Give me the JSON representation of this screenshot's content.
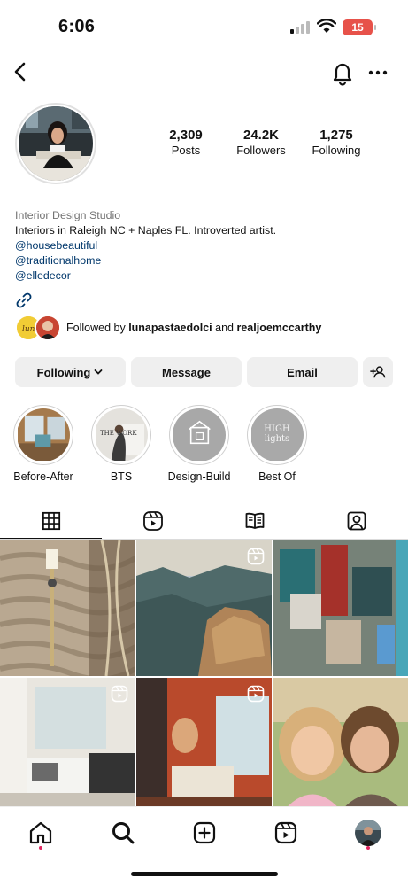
{
  "status_bar": {
    "time": "6:06",
    "battery": "15"
  },
  "profile": {
    "stats": [
      {
        "value": "2,309",
        "label": "Posts"
      },
      {
        "value": "24.2K",
        "label": "Followers"
      },
      {
        "value": "1,275",
        "label": "Following"
      }
    ],
    "category": "Interior Design Studio",
    "bio": "Interiors in Raleigh NC + Naples FL. Introverted artist.",
    "links": [
      "@housebeautiful",
      "@traditionalhome",
      "@elledecor"
    ],
    "followed_by": {
      "prefix": "Followed by ",
      "user1": "lunapastaedolci",
      "joiner": " and ",
      "user2": "realjoemccarthy"
    }
  },
  "actions": {
    "following": "Following",
    "message": "Message",
    "email": "Email"
  },
  "highlights": [
    {
      "label": "Before-After"
    },
    {
      "label": "BTS",
      "cover_text": "THE WORK"
    },
    {
      "label": "Design-Build"
    },
    {
      "label": "Best Of",
      "cover_text": "HIGH lights"
    }
  ],
  "tabs": [
    "grid-icon",
    "reels-icon",
    "guides-icon",
    "tagged-icon"
  ],
  "colors": {
    "link": "#00376b",
    "category": "#737373",
    "button_bg": "#efefef",
    "notification_dot": "#e0245e",
    "battery": "#e7524a"
  }
}
